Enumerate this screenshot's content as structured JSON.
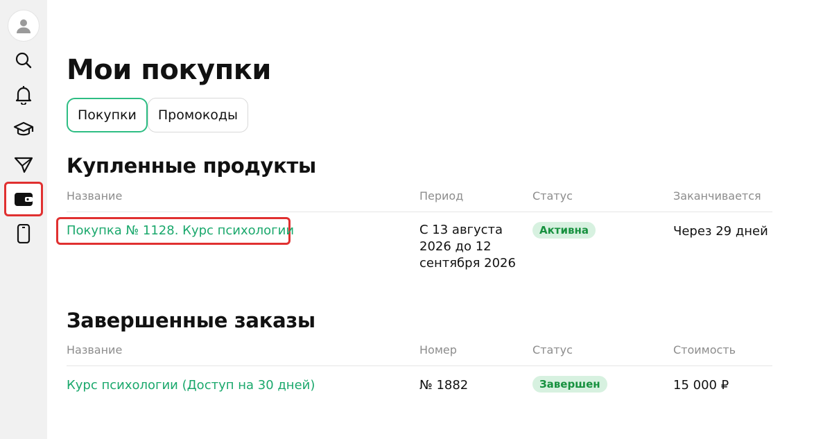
{
  "page": {
    "title": "Мои покупки"
  },
  "tabs": [
    {
      "label": "Покупки",
      "active": true
    },
    {
      "label": "Промокоды",
      "active": false
    }
  ],
  "purchased_products": {
    "title": "Купленные продукты",
    "columns": [
      "Название",
      "Период",
      "Статус",
      "Заканчивается"
    ],
    "rows": [
      {
        "name": "Покупка № 1128. Курс психологии",
        "period_line1": "С 13 августа",
        "period_line2": "2026 до 12",
        "period_line3": "сентября 2026",
        "status": "Активна",
        "ends": "Через 29 дней"
      }
    ]
  },
  "completed_orders": {
    "title": "Завершенные заказы",
    "columns": [
      "Название",
      "Номер",
      "Статус",
      "Стоимость"
    ],
    "rows": [
      {
        "name": "Курс психологии (Доступ на 30 дней)",
        "number": "№ 1882",
        "status": "Завершен",
        "cost": "15 000 ₽"
      }
    ]
  },
  "sidebar": {
    "items": [
      {
        "icon": "user-icon"
      },
      {
        "icon": "search-icon"
      },
      {
        "icon": "bell-icon"
      },
      {
        "icon": "graduation-cap-icon"
      },
      {
        "icon": "send-icon"
      },
      {
        "icon": "wallet-icon",
        "active": true
      },
      {
        "icon": "phone-icon"
      }
    ]
  },
  "colors": {
    "accent": "#2dbd83",
    "link": "#1aa86c",
    "badge_bg": "#d7f1e0",
    "badge_text": "#17913f",
    "highlight": "#e03030",
    "sidebar_bg": "#f1f1f1"
  }
}
